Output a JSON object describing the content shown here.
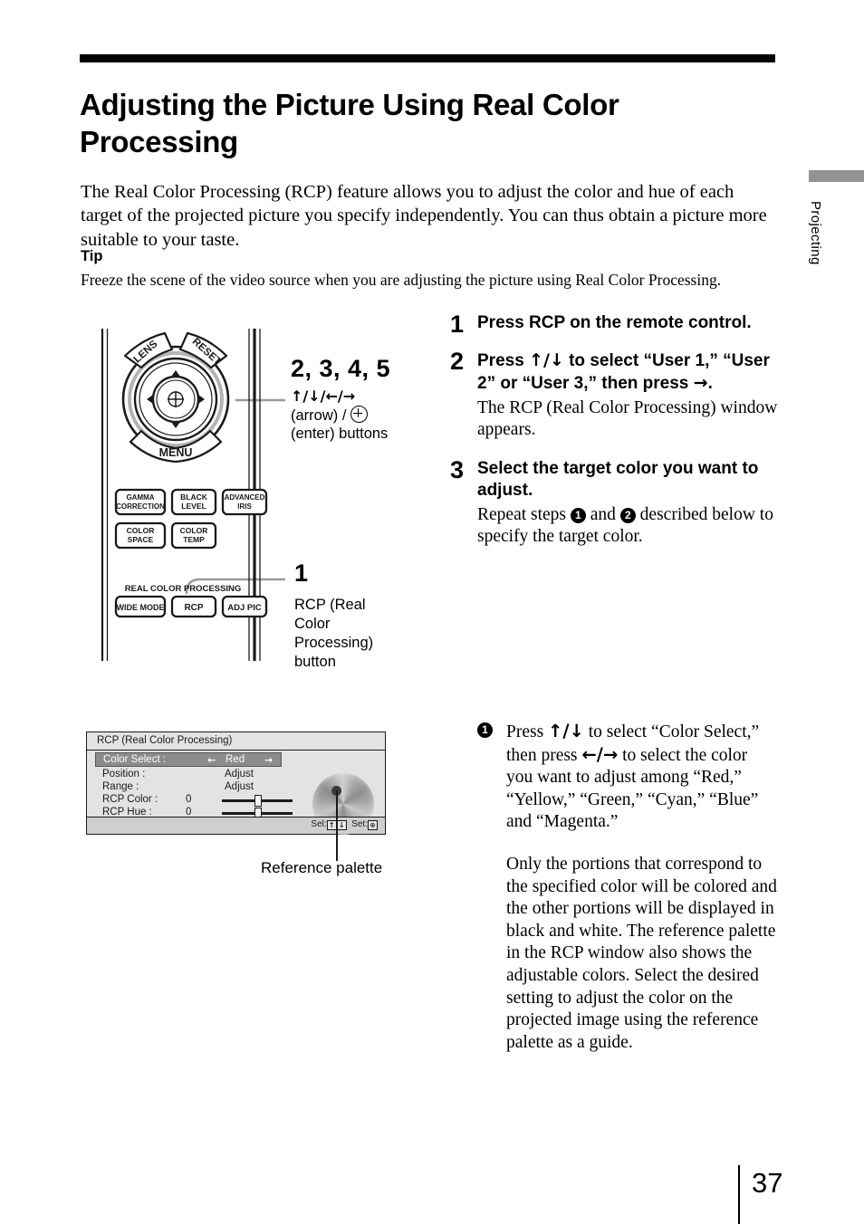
{
  "document": {
    "page_number": "37",
    "side_tab_label": "Projecting",
    "title": "Adjusting the Picture Using Real Color Processing",
    "intro": "The Real Color Processing (RCP) feature allows you to adjust the color and hue of each target of the projected picture you specify independently. You can thus obtain a picture more suitable to your taste.",
    "tip_label": "Tip",
    "tip_text": "Freeze the scene of the video source when you are adjusting the picture using Real Color Processing."
  },
  "remote_figure": {
    "disc_buttons": {
      "lens": "LENS",
      "reset": "RESET",
      "menu": "MENU"
    },
    "function_buttons": [
      "GAMMA CORRECTION",
      "BLACK LEVEL",
      "ADVANCED IRIS",
      "COLOR SPACE",
      "COLOR TEMP"
    ],
    "section_label": "REAL COLOR PROCESSING",
    "rcp_row_buttons": [
      "WIDE MODE",
      "RCP",
      "ADJ PIC"
    ],
    "callouts": [
      {
        "number": "2, 3, 4, 5",
        "arrows": "↑/↓/←/→",
        "line1": "(arrow) /",
        "line2": "(enter) buttons"
      },
      {
        "number": "1",
        "label": "RCP (Real Color Processing) button"
      }
    ]
  },
  "steps": [
    {
      "num": "1",
      "head": "Press RCP on the remote control.",
      "body": ""
    },
    {
      "num": "2",
      "head_parts": [
        "Press ",
        "↑/↓",
        " to select “User 1,” “User 2” or “User 3,” then press ",
        "→",
        "."
      ],
      "body": "The RCP (Real Color Processing) window appears."
    },
    {
      "num": "3",
      "head": "Select the target color you want to adjust.",
      "body_parts": [
        "Repeat steps ",
        "1",
        " and ",
        "2",
        " described below to specify the target color."
      ]
    }
  ],
  "rcp_window": {
    "title": "RCP (Real Color Processing)",
    "rows": [
      {
        "label": "Color Select :",
        "value": "Red",
        "type": "selector",
        "left_arrow": "←",
        "right_arrow": "→"
      },
      {
        "label": "Position :",
        "value": "Adjust",
        "type": "text"
      },
      {
        "label": "Range :",
        "value": "Adjust",
        "type": "text"
      },
      {
        "label": "RCP Color :",
        "value": "0",
        "type": "slider"
      },
      {
        "label": "RCP Hue :",
        "value": "0",
        "type": "slider"
      }
    ],
    "status_sel_label": "Sel:",
    "status_sel_keys": [
      "↑",
      "↓"
    ],
    "status_set_label": "Set:",
    "status_set_key": "⊕",
    "caption": "Reference palette"
  },
  "right_body": {
    "marker": "1",
    "sub_paragraph_parts": [
      "Press ",
      "↑/↓",
      " to select “Color Select,” then press ",
      "←/→",
      " to select the color you want to adjust among “Red,” “Yellow,” “Green,” “Cyan,” “Blue” and “Magenta.”"
    ],
    "paragraph_2": "Only the portions that correspond to the specified color will be colored and the other portions will be displayed in black and white. The reference palette in the RCP window also shows the adjustable colors. Select the desired setting to adjust the color on the projected image using the reference palette as a guide."
  },
  "colors": {
    "rule": "#000000",
    "side_tab": "#939393",
    "window_bg": "#e3e3e3",
    "window_status_bg": "#cfcfcf",
    "selected_row": "#8c8c8c"
  }
}
